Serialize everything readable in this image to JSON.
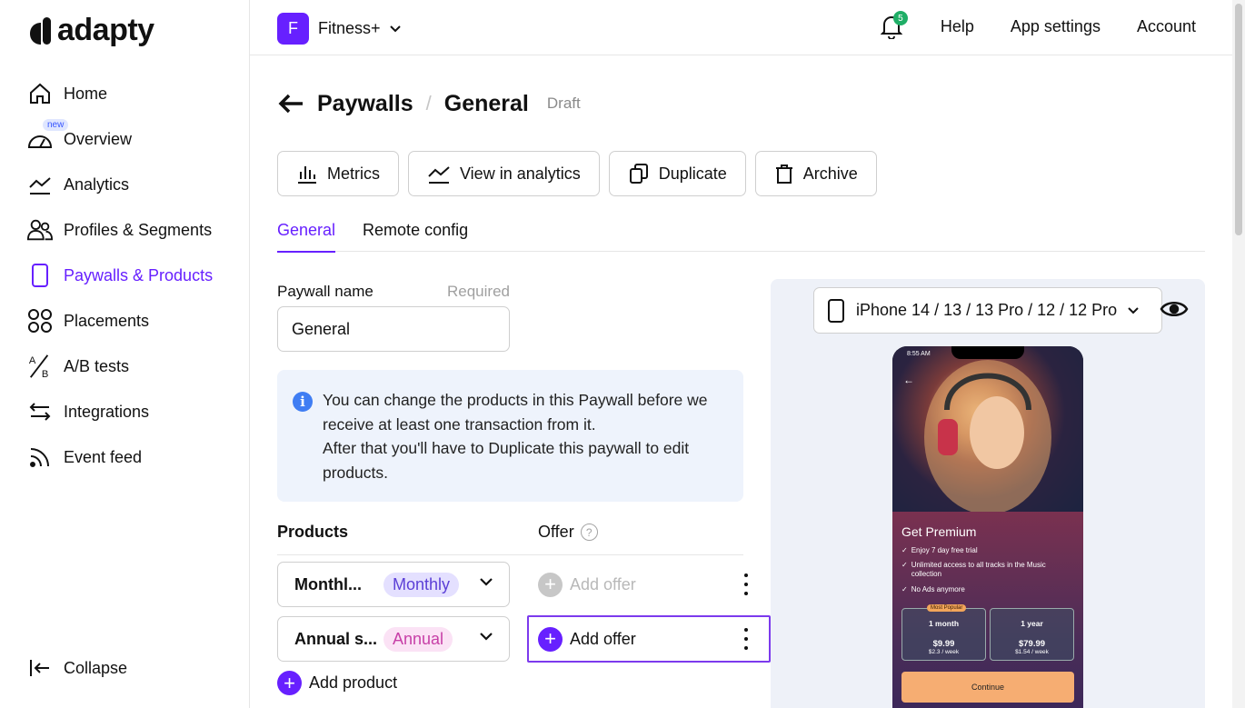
{
  "brand": {
    "name": "adapty",
    "accent": "#6720ff"
  },
  "sidebar": {
    "items": [
      {
        "label": "Home",
        "icon": "home-icon"
      },
      {
        "label": "Overview",
        "icon": "gauge-icon",
        "badge": "new"
      },
      {
        "label": "Analytics",
        "icon": "chart-line-icon"
      },
      {
        "label": "Profiles & Segments",
        "icon": "users-icon"
      },
      {
        "label": "Paywalls & Products",
        "icon": "phone-icon",
        "active": true
      },
      {
        "label": "Placements",
        "icon": "grid-icon"
      },
      {
        "label": "A/B tests",
        "icon": "ab-test-icon"
      },
      {
        "label": "Integrations",
        "icon": "arrows-icon"
      },
      {
        "label": "Event feed",
        "icon": "feed-icon"
      }
    ],
    "collapse_label": "Collapse"
  },
  "topbar": {
    "app_initial": "F",
    "app_name": "Fitness+",
    "notification_count": "5",
    "help": "Help",
    "app_settings": "App settings",
    "account": "Account"
  },
  "breadcrumb": {
    "parent": "Paywalls",
    "separator": "/",
    "title": "General",
    "status": "Draft"
  },
  "actions": {
    "metrics": "Metrics",
    "view_analytics": "View in analytics",
    "duplicate": "Duplicate",
    "archive": "Archive"
  },
  "tabs": [
    {
      "label": "General",
      "active": true
    },
    {
      "label": "Remote config"
    }
  ],
  "paywall_name": {
    "label": "Paywall name",
    "required": "Required",
    "value": "General"
  },
  "info": {
    "line1": "You can change the products in this Paywall before we receive at least one transaction from it.",
    "line2": "After that you'll have to Duplicate this paywall to edit products."
  },
  "products": {
    "header": "Products",
    "offer_header": "Offer",
    "rows": [
      {
        "name": "Monthl...",
        "chip": "Monthly",
        "offer": "Add offer"
      },
      {
        "name": "Annual s...",
        "chip": "Annual",
        "offer": "Add offer"
      }
    ],
    "add_product": "Add product"
  },
  "preview": {
    "device": "iPhone 14 / 13 / 13 Pro / 12 / 12 Pro",
    "phone": {
      "time": "8:55 AM",
      "title": "Get Premium",
      "features": [
        "Enjoy 7 day free trial",
        "Unlimited access to all tracks in the Music collection",
        "No Ads anymore"
      ],
      "plans": [
        {
          "badge": "Most Popular",
          "name": "1 month",
          "price": "$9.99",
          "sub": "$2.3 / week"
        },
        {
          "name": "1 year",
          "price": "$79.99",
          "sub": "$1.54 / week"
        }
      ],
      "cta": "Continue"
    }
  }
}
